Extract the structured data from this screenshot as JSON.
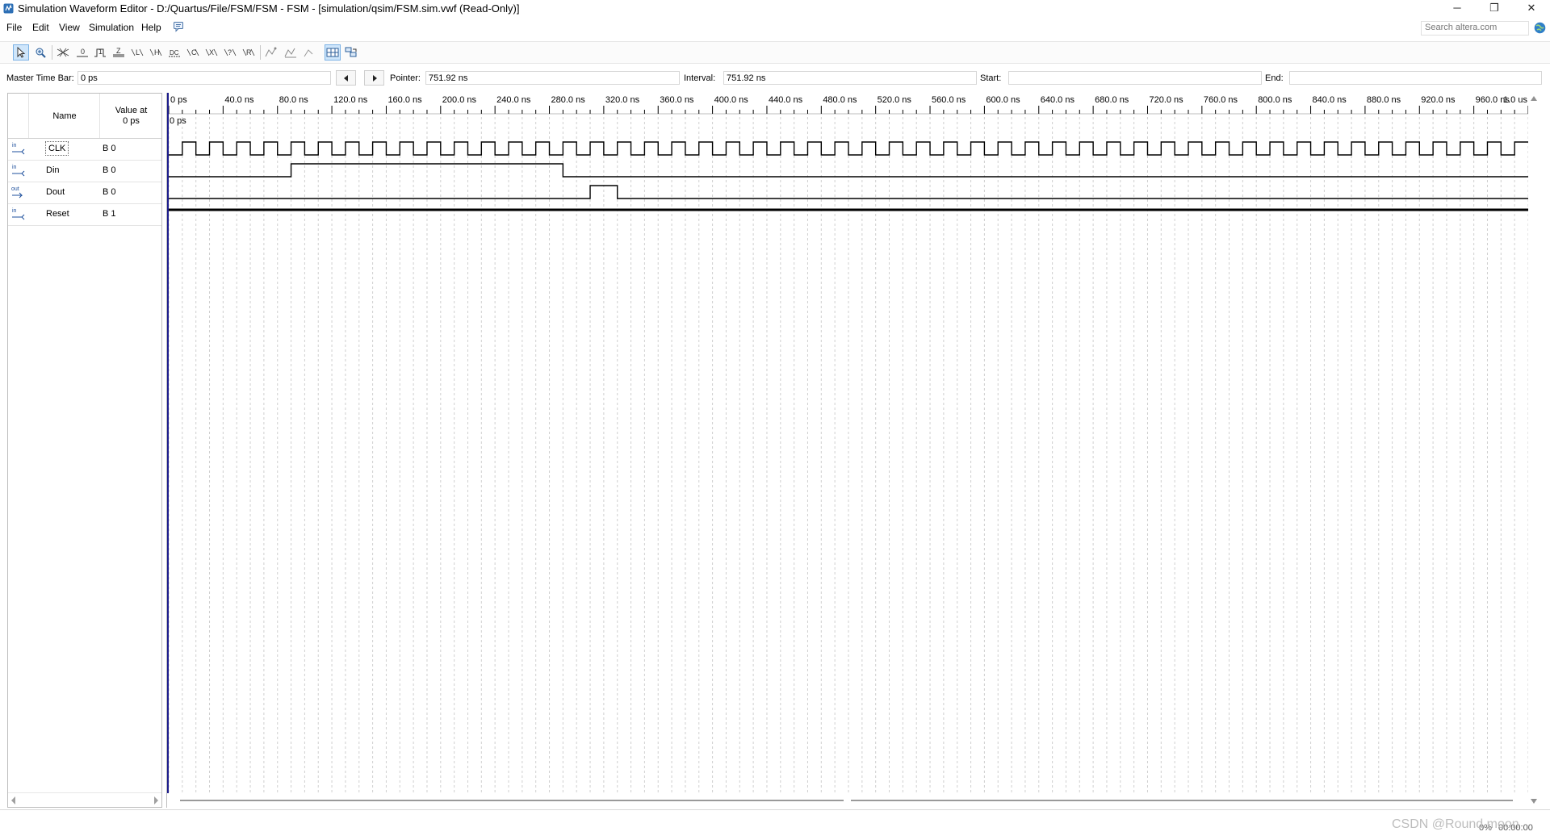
{
  "window": {
    "title": "Simulation Waveform Editor - D:/Quartus/File/FSM/FSM - FSM - [simulation/qsim/FSM.sim.vwf (Read-Only)]",
    "minimize": "─",
    "restore": "❐",
    "close": "✕"
  },
  "menu": [
    "File",
    "Edit",
    "View",
    "Simulation",
    "Help"
  ],
  "search": {
    "placeholder": "Search altera.com"
  },
  "toolbar": [
    "selection-tool",
    "zoom-tool",
    "unknown-x",
    "force-low-0",
    "force-high-1",
    "high-impedance-z",
    "weak-low-l",
    "weak-high-h",
    "dont-care-dc",
    "invert",
    "count-value",
    "clock",
    "arbitrary-value",
    "random-value",
    "snap-to-grid",
    "align-transitions",
    "show-grid",
    "waveform-compare",
    "sort"
  ],
  "timebar": {
    "master_label": "Master Time Bar:",
    "master_value": "0 ps",
    "pointer_label": "Pointer:",
    "pointer_value": "751.92 ns",
    "interval_label": "Interval:",
    "interval_value": "751.92 ns",
    "start_label": "Start:",
    "start_value": "",
    "end_label": "End:",
    "end_value": ""
  },
  "signal_table": {
    "name_header": "Name",
    "value_header_line1": "Value at",
    "value_header_line2": "0 ps",
    "signals": [
      {
        "dir": "in",
        "name": "CLK",
        "value": "B 0"
      },
      {
        "dir": "in",
        "name": "Din",
        "value": "B 0"
      },
      {
        "dir": "out",
        "name": "Dout",
        "value": "B 0"
      },
      {
        "dir": "in",
        "name": "Reset",
        "value": "B 1"
      }
    ]
  },
  "waveform": {
    "time_unit": "ns",
    "range_ns": [
      0,
      1000
    ],
    "tick_step_ns": 40,
    "tick_labels": [
      "0 ps",
      "40.0 ns",
      "80.0 ns",
      "120.0 ns",
      "160.0 ns",
      "200.0 ns",
      "240.0 ns",
      "280.0 ns",
      "320.0 ns",
      "360.0 ns",
      "400.0 ns",
      "440.0 ns",
      "480.0 ns",
      "520.0 ns",
      "560.0 ns",
      "600.0 ns",
      "640.0 ns",
      "680.0 ns",
      "720.0 ns",
      "760.0 ns",
      "800.0 ns",
      "840.0 ns",
      "880.0 ns",
      "920.0 ns",
      "960.0 ns",
      "1.0 us"
    ],
    "marker_label": "0 ps",
    "grid": true,
    "clk_period_ns": 20,
    "clk_initial": 0,
    "traces": [
      {
        "name": "CLK",
        "type": "clock"
      },
      {
        "name": "Din",
        "type": "digital",
        "transitions": [
          [
            0,
            0
          ],
          [
            90,
            1
          ],
          [
            290,
            0
          ]
        ]
      },
      {
        "name": "Dout",
        "type": "digital",
        "transitions": [
          [
            0,
            0
          ],
          [
            310,
            1
          ],
          [
            330,
            0
          ]
        ]
      },
      {
        "name": "Reset",
        "type": "constant-high-bold",
        "transitions": [
          [
            0,
            1
          ]
        ]
      }
    ]
  },
  "status": {
    "percent": "0%",
    "time": "00:00:00"
  },
  "watermark": "CSDN @Round moon"
}
